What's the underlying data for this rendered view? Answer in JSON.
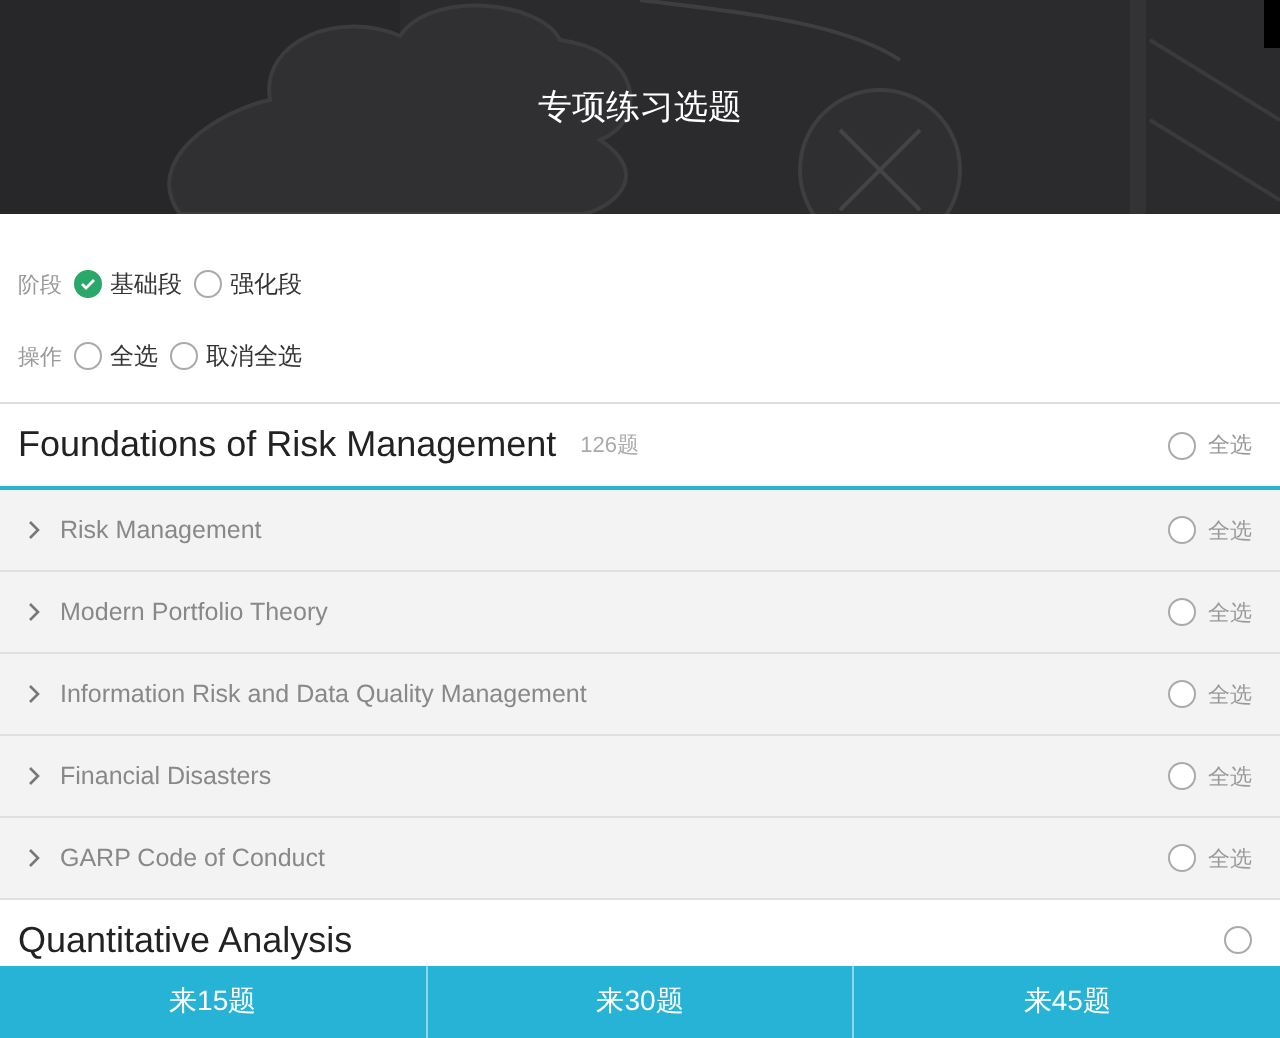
{
  "header": {
    "title": "专项练习选题"
  },
  "stage": {
    "label": "阶段",
    "options": [
      {
        "label": "基础段",
        "selected": true
      },
      {
        "label": "强化段",
        "selected": false
      }
    ]
  },
  "operation": {
    "label": "操作",
    "options": [
      {
        "label": "全选",
        "selected": false
      },
      {
        "label": "取消全选",
        "selected": false
      }
    ]
  },
  "categories": [
    {
      "title": "Foundations of Risk Management",
      "count": "126题",
      "select_label": "全选",
      "checked": false,
      "expanded": true,
      "children": [
        {
          "title": "Risk Management",
          "select_label": "全选",
          "checked": false
        },
        {
          "title": "Modern Portfolio Theory",
          "select_label": "全选",
          "checked": false
        },
        {
          "title": "Information Risk and Data Quality Management",
          "select_label": "全选",
          "checked": false
        },
        {
          "title": "Financial Disasters",
          "select_label": "全选",
          "checked": false
        },
        {
          "title": "GARP Code of Conduct",
          "select_label": "全选",
          "checked": false
        }
      ]
    },
    {
      "title": "Quantitative Analysis",
      "checked": false,
      "expanded": false
    }
  ],
  "footer_buttons": [
    "来15题",
    "来30题",
    "来45题"
  ]
}
